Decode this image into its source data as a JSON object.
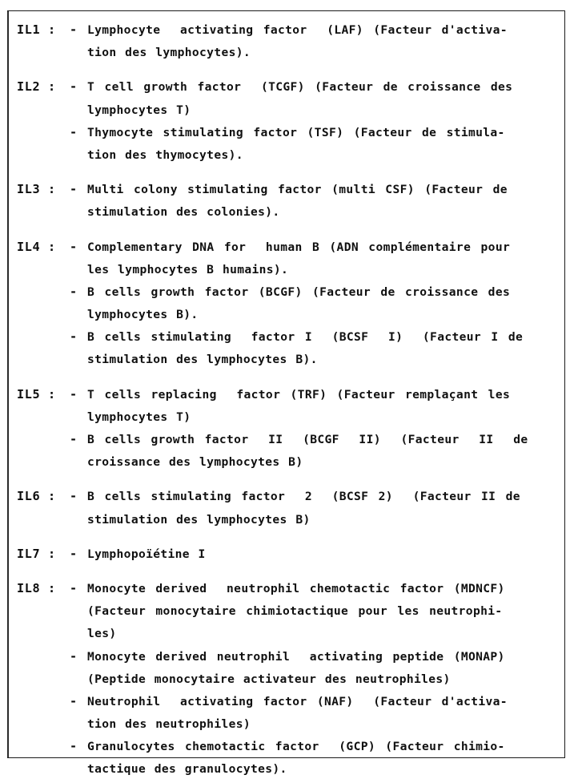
{
  "document": {
    "type": "interleukin-nomenclature-table",
    "language": "en-fr",
    "entries": [
      {
        "label": "IL1 :",
        "items": [
          {
            "bullet": "-",
            "lines": [
              "Lymphocyte  activating factor  (LAF) (Facteur d'activa-",
              "tion des lymphocytes)."
            ]
          }
        ]
      },
      {
        "label": "IL2 :",
        "items": [
          {
            "bullet": "-",
            "lines": [
              "T cell growth factor  (TCGF) (Facteur de croissance des",
              "lymphocytes T)"
            ]
          },
          {
            "bullet": "-",
            "lines": [
              "Thymocyte stimulating factor (TSF) (Facteur de stimula-",
              "tion des thymocytes)."
            ]
          }
        ]
      },
      {
        "label": "IL3 :",
        "items": [
          {
            "bullet": "-",
            "lines": [
              "Multi colony stimulating factor (multi CSF) (Facteur de",
              "stimulation des colonies)."
            ]
          }
        ]
      },
      {
        "label": "IL4 :",
        "items": [
          {
            "bullet": "-",
            "lines": [
              "Complementary DNA for  human B (ADN complémentaire pour",
              "les lymphocytes B humains)."
            ]
          },
          {
            "bullet": "-",
            "lines": [
              "B cells growth factor (BCGF) (Facteur de croissance des",
              "lymphocytes B)."
            ]
          },
          {
            "bullet": "-",
            "lines": [
              "B cells stimulating  factor I  (BCSF  I)  (Facteur I de",
              "stimulation des lymphocytes B)."
            ]
          }
        ]
      },
      {
        "label": "IL5 :",
        "items": [
          {
            "bullet": "-",
            "lines": [
              "T cells replacing  factor (TRF) (Facteur remplaçant les",
              "lymphocytes T)"
            ]
          },
          {
            "bullet": "-",
            "lines": [
              "B cells growth factor  II  (BCGF  II)  (Facteur  II  de",
              "croissance des lymphocytes B)"
            ]
          }
        ]
      },
      {
        "label": "IL6 :",
        "items": [
          {
            "bullet": "-",
            "lines": [
              "B cells stimulating factor  2  (BCSF 2)  (Facteur II de",
              "stimulation des lymphocytes B)"
            ]
          }
        ]
      },
      {
        "label": "IL7 :",
        "items": [
          {
            "bullet": "-",
            "lines": [
              "Lymphopoïétine I"
            ]
          }
        ]
      },
      {
        "label": "IL8 :",
        "items": [
          {
            "bullet": "-",
            "lines": [
              "Monocyte derived  neutrophil chemotactic factor (MDNCF)",
              "(Facteur monocytaire chimiotactique pour les neutrophi-",
              "les)"
            ]
          },
          {
            "bullet": "-",
            "lines": [
              "Monocyte derived neutrophil  activating peptide (MONAP)",
              "(Peptide monocytaire activateur des neutrophiles)"
            ]
          },
          {
            "bullet": "-",
            "lines": [
              "Neutrophil  activating factor (NAF)  (Facteur d'activa-",
              "tion des neutrophiles)"
            ]
          },
          {
            "bullet": "-",
            "lines": [
              "Granulocytes chemotactic factor  (GCP) (Facteur chimio-",
              "tactique des granulocytes)."
            ]
          }
        ]
      }
    ]
  },
  "style": {
    "text_color": "#101010",
    "background_color": "#ffffff",
    "border_color": "#1b1b1b"
  }
}
